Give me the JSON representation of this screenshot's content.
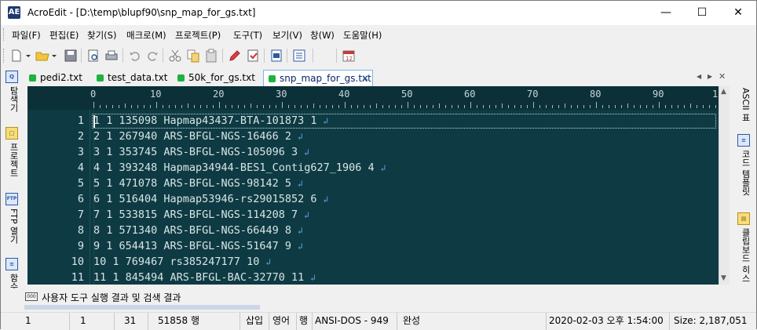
{
  "window": {
    "app_icon_text": "AE",
    "title": "AcroEdit - [D:\\temp\\blupf90\\snp_map_for_gs.txt]",
    "minimize": "—",
    "maximize": "☐",
    "close": "✕"
  },
  "menu": [
    "파일(F)",
    "편집(E)",
    "찾기(S)",
    "매크로(M)",
    "프로젝트(P)",
    "도구(T)",
    "보기(V)",
    "창(W)",
    "도움말(H)"
  ],
  "tabs": [
    {
      "label": "pedi2.txt",
      "active": false
    },
    {
      "label": "test_data.txt",
      "active": false
    },
    {
      "label": "50k_for_gs.txt",
      "active": false
    },
    {
      "label": "snp_map_for_gs.txt",
      "active": true
    }
  ],
  "tab_close": "✕",
  "tab_nav": {
    "prev": "◀",
    "next": "▶",
    "close": "✕"
  },
  "left_panel": [
    {
      "icon_text": "Q",
      "label": "탐색기"
    },
    {
      "icon_text": "□",
      "label": "프로젝트"
    },
    {
      "icon_text": "FTP",
      "label": "FTP 열기"
    },
    {
      "icon_text": "≡",
      "label": "함수"
    }
  ],
  "right_panel": [
    {
      "label": "ASCII 표"
    },
    {
      "label": "코드 템플릿"
    },
    {
      "label": "클립보드 히스"
    }
  ],
  "ruler": [
    "0",
    "10",
    "20",
    "30",
    "40",
    "50",
    "60",
    "70",
    "80",
    "90",
    "1"
  ],
  "lines": [
    {
      "num": "1",
      "text": "1 1 135098 Hapmap43437-BTA-101873 1"
    },
    {
      "num": "2",
      "text": "2 1 267940 ARS-BFGL-NGS-16466 2"
    },
    {
      "num": "3",
      "text": "3 1 353745 ARS-BFGL-NGS-105096 3"
    },
    {
      "num": "4",
      "text": "4 1 393248 Hapmap34944-BES1_Contig627_1906 4"
    },
    {
      "num": "5",
      "text": "5 1 471078 ARS-BFGL-NGS-98142 5"
    },
    {
      "num": "6",
      "text": "6 1 516404 Hapmap53946-rs29015852 6"
    },
    {
      "num": "7",
      "text": "7 1 533815 ARS-BFGL-NGS-114208 7"
    },
    {
      "num": "8",
      "text": "8 1 571340 ARS-BFGL-NGS-66449 8"
    },
    {
      "num": "9",
      "text": "9 1 654413 ARS-BFGL-NGS-51647 9"
    },
    {
      "num": "10",
      "text": "10 1 769467 rs385247177 10"
    },
    {
      "num": "11",
      "text": "11 1 845494 ARS-BFGL-BAC-32770 11"
    }
  ],
  "eol_mark": "↲",
  "output_panel": {
    "icon_text": "000",
    "label": "사용자 도구 실행 결과 및 검색 결과"
  },
  "status": {
    "line": "1",
    "col": "1",
    "char": "31",
    "total_lines": "51858 행",
    "insert": "삽입",
    "lang": "영어",
    "row_mode": "행",
    "encoding": "ANSI-DOS - 949",
    "state": "완성",
    "datetime": "2020-02-03 오후 1:54:00",
    "size": "Size: 2,187,051"
  }
}
